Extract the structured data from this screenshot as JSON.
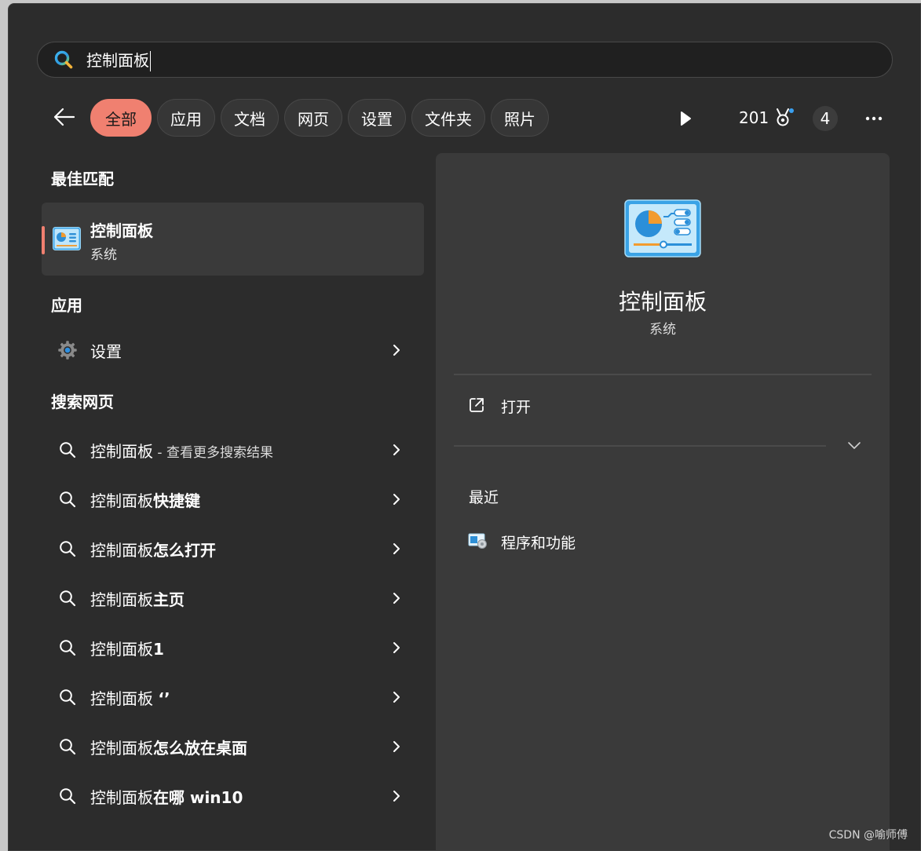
{
  "search": {
    "query": "控制面板"
  },
  "filters": {
    "chips": [
      "全部",
      "应用",
      "文档",
      "网页",
      "设置",
      "文件夹",
      "照片"
    ],
    "active_index": 0,
    "points": "201",
    "badge_count": "4"
  },
  "best_match": {
    "section": "最佳匹配",
    "title": "控制面板",
    "subtitle": "系统"
  },
  "apps": {
    "section": "应用",
    "items": [
      {
        "label": "设置",
        "icon": "gear-icon"
      }
    ]
  },
  "web": {
    "section": "搜索网页",
    "items": [
      {
        "base": "控制面板",
        "muted": " - 查看更多搜索结果",
        "bold": ""
      },
      {
        "base": "控制面板",
        "muted": "",
        "bold": "快捷键"
      },
      {
        "base": "控制面板",
        "muted": "",
        "bold": "怎么打开"
      },
      {
        "base": "控制面板",
        "muted": "",
        "bold": "主页"
      },
      {
        "base": "控制面板",
        "muted": "",
        "bold": "1"
      },
      {
        "base": "控制面板 ",
        "muted": "",
        "bold": "‘’"
      },
      {
        "base": "控制面板",
        "muted": "",
        "bold": "怎么放在桌面"
      },
      {
        "base": "控制面板",
        "muted": "",
        "bold": "在哪 win10"
      }
    ]
  },
  "preview": {
    "title": "控制面板",
    "subtitle": "系统",
    "open_label": "打开",
    "recent_section": "最近",
    "recent_items": [
      "程序和功能"
    ]
  },
  "colors": {
    "accent": "#f08070",
    "panel": "#3a3a3a",
    "background": "#2c2c2c"
  },
  "watermark": "CSDN @喻师傅"
}
